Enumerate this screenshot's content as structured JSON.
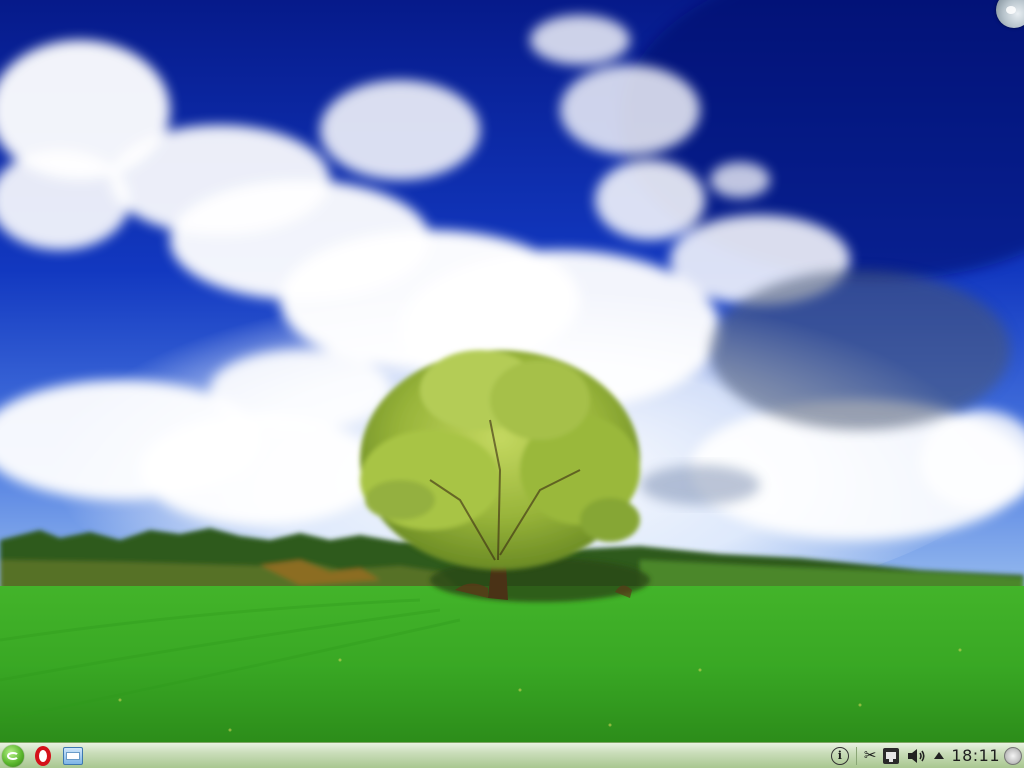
{
  "wallpaper": {
    "sky_color": "#0a2a9c",
    "cloud_color": "#ffffff",
    "grass_color": "#3fae25",
    "tree_color": "#8fb52e"
  },
  "panel": {
    "background": "#c9ddb9",
    "launcher": {
      "icon": "application-launcher-icon"
    },
    "tasks": [
      {
        "icon": "opera-browser-icon"
      },
      {
        "icon": "file-manager-icon"
      }
    ],
    "tray": {
      "items": [
        {
          "icon": "info-icon",
          "glyph": "i"
        },
        {
          "icon": "scissors-icon",
          "glyph": "✂"
        },
        {
          "icon": "network-icon"
        },
        {
          "icon": "volume-icon",
          "glyph": "🔊"
        },
        {
          "icon": "show-hidden-icons-icon"
        }
      ],
      "clock": "18:11",
      "cashew_icon": "panel-toolbox-icon"
    }
  },
  "desktop_corner": {
    "icon": "desktop-toolbox-icon"
  }
}
